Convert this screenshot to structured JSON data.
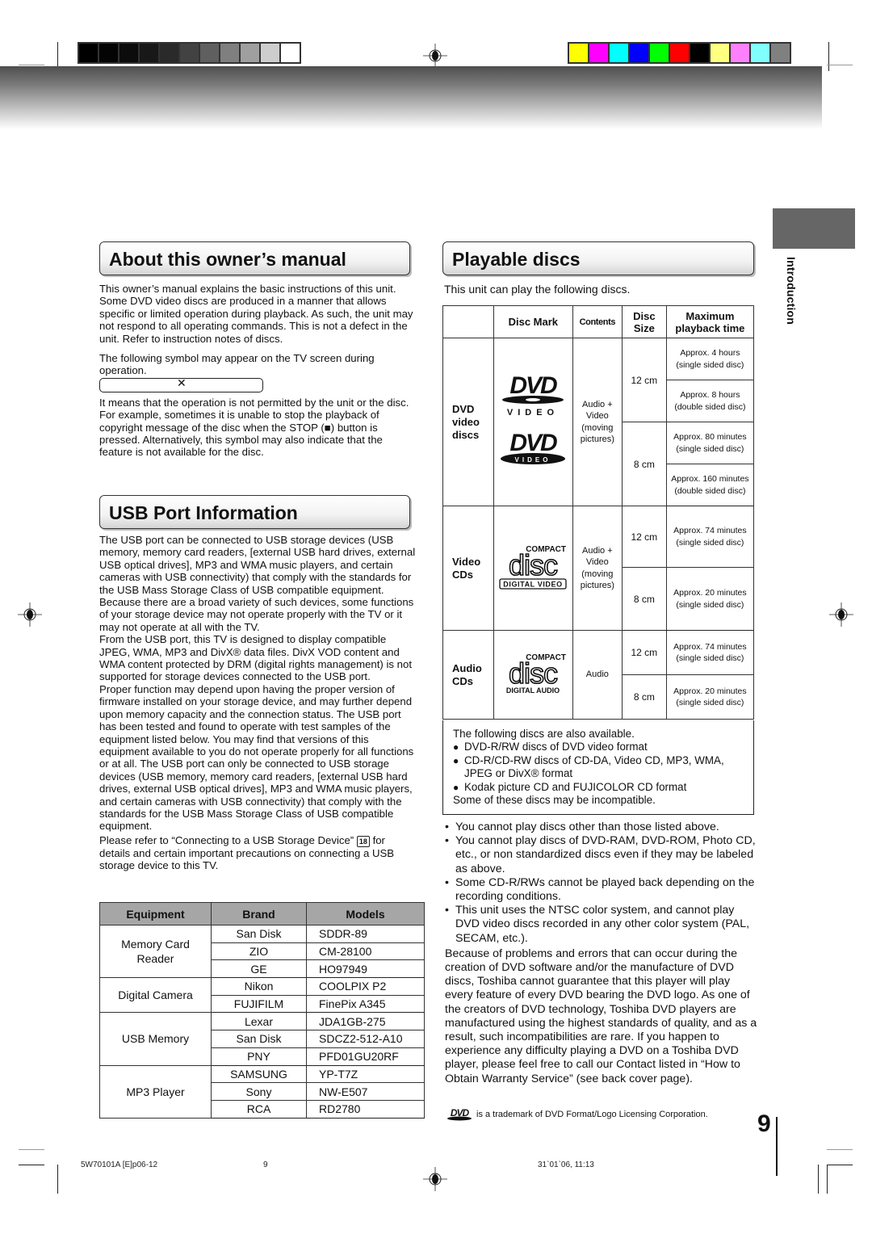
{
  "print_marks": {
    "gray_swatches": [
      "#000000",
      "#040404",
      "#0c0c0c",
      "#181818",
      "#2a2a2a",
      "#424242",
      "#5f5f5f",
      "#7f7f7f",
      "#9f9f9f",
      "#cdcdcd",
      "#ffffff"
    ],
    "color_swatches": [
      "#ffff00",
      "#ff00ff",
      "#00ffff",
      "#0000ff",
      "#00ff00",
      "#ff0000",
      "#000000",
      "#ffff80",
      "#ff80ff",
      "#80ffff",
      "#808080"
    ]
  },
  "side_tab": {
    "label": "Introduction",
    "color": "#666666"
  },
  "about": {
    "title": "About this owner’s manual",
    "p1": "This owner’s manual explains the basic instructions of this unit. Some DVD video discs are produced in a manner that allows specific or limited operation during playback. As such, the unit may not respond to all operating commands. This is not a defect in the unit. Refer to instruction notes of discs.",
    "p2": "The following symbol may appear on the TV screen during operation.",
    "symbol": "✕",
    "p3": "It means that the operation is not permitted by the unit or the disc.",
    "p4a": "For example, sometimes it is unable to stop the playback of copyright message of the disc when the STOP (",
    "stop_glyph": "■",
    "p4b": ") button is pressed. Alternatively, this symbol may also indicate that the feature is not available for the disc."
  },
  "usb": {
    "title": "USB Port Information",
    "p1": "The USB port can be connected to USB storage devices (USB memory, memory card readers, [external USB hard drives, external USB optical drives], MP3 and WMA music players, and certain cameras with USB connectivity) that comply with the standards for the USB Mass Storage Class of USB compatible equipment.  Because there are a broad variety of such devices, some functions of your storage device may not operate properly with the TV or it may not operate at all with the TV.",
    "p2": "From the USB port, this TV is designed to display compatible JPEG, WMA, MP3 and DivX® data files. DivX VOD content and WMA content protected by DRM (digital rights management) is not supported for storage devices connected to the USB port.",
    "p3": "Proper function may depend upon having the proper version of firmware installed on your storage device, and may further depend upon memory capacity and the connection status. The USB port has been tested and found to operate with test samples of the equipment listed below.  You may find that versions of this equipment available to you do not operate properly for all functions or at all. The USB port can only be connected to USB storage devices (USB memory, memory card readers, [external USB hard drives, external USB optical drives], MP3 and WMA music players, and certain cameras with USB connectivity) that comply with the standards for the USB Mass Storage Class of USB compatible equipment.",
    "p4a": "Please refer to “Connecting to a USB Storage Device”",
    "p4_ref": "18",
    "p4b": "for details and certain important precautions on connecting a USB storage device to this TV."
  },
  "equipment_table": {
    "headers": [
      "Equipment",
      "Brand",
      "Models"
    ],
    "groups": [
      {
        "equipment": "Memory Card Reader",
        "rows": [
          [
            "San Disk",
            "SDDR-89"
          ],
          [
            "ZIO",
            "CM-28100"
          ],
          [
            "GE",
            "HO97949"
          ]
        ]
      },
      {
        "equipment": "Digital Camera",
        "rows": [
          [
            "Nikon",
            "COOLPIX P2"
          ],
          [
            "FUJIFILM",
            "FinePix A345"
          ]
        ]
      },
      {
        "equipment": "USB Memory",
        "rows": [
          [
            "Lexar",
            "JDA1GB-275"
          ],
          [
            "San Disk",
            "SDCZ2-512-A10"
          ],
          [
            "PNY",
            "PFD01GU20RF"
          ]
        ]
      },
      {
        "equipment": "MP3 Player",
        "rows": [
          [
            "SAMSUNG",
            "YP-T7Z"
          ],
          [
            "Sony",
            "NW-E507"
          ],
          [
            "RCA",
            "RD2780"
          ]
        ]
      }
    ]
  },
  "playable": {
    "title": "Playable discs",
    "intro": "This unit can play the following discs.",
    "headers": {
      "mark": "Disc Mark",
      "contents": "Contents",
      "size": "Disc Size",
      "time": "Maximum playback time"
    },
    "dvd": {
      "type": "DVD video discs",
      "contents": "Audio + Video (moving pictures)",
      "logo_text": "VIDEO",
      "sizes": [
        "12 cm",
        "8 cm"
      ],
      "times": [
        "Approx. 4 hours (single sided disc)",
        "Approx. 8 hours (double sided disc)",
        "Approx. 80 minutes (single sided disc)",
        "Approx. 160 minutes (double sided disc)"
      ]
    },
    "vcd": {
      "type": "Video CDs",
      "contents": "Audio + Video (moving pictures)",
      "logo_top": "COMPACT",
      "logo_bottom": "DIGITAL VIDEO",
      "sizes": [
        "12 cm",
        "8 cm"
      ],
      "times": [
        "Approx. 74 minutes (single sided disc)",
        "Approx. 20 minutes (single sided disc)"
      ]
    },
    "acd": {
      "type": "Audio CDs",
      "contents": "Audio",
      "logo_top": "COMPACT",
      "logo_bottom": "DIGITAL AUDIO",
      "sizes": [
        "12 cm",
        "8 cm"
      ],
      "times": [
        "Approx. 74 minutes (single sided disc)",
        "Approx. 20 minutes (single sided disc)"
      ]
    },
    "also": {
      "intro": "The following discs are also available.",
      "items": [
        "DVD-R/RW discs of DVD video format",
        "CD-R/CD-RW discs of CD-DA, Video CD, MP3, WMA, JPEG or DivX® format",
        "Kodak picture CD and FUJICOLOR CD format"
      ],
      "outro": "Some of these discs may be incompatible."
    },
    "notes": [
      "You cannot play discs other than those listed above.",
      "You cannot play discs of DVD-RAM, DVD-ROM, Photo CD, etc., or non standardized discs even if they may be labeled as above.",
      "Some CD-R/RWs cannot be played back depending on the recording conditions.",
      "This unit uses the NTSC color system, and cannot play DVD video discs recorded in any other color system (PAL, SECAM, etc.)."
    ],
    "paragraph": "Because of problems and errors that can occur during the creation of DVD software and/or the manufacture of DVD discs, Toshiba cannot guarantee that this player will play every feature of every DVD bearing the DVD logo.  As one of the creators of DVD technology, Toshiba DVD players are manufactured using the highest standards of quality, and as a result, such incompatibilities are rare.  If you happen to experience any difficulty playing a DVD on a Toshiba DVD player, please feel free to call our Contact listed in “How to Obtain Warranty Service” (see back cover page).",
    "trademark": "is a trademark of DVD Format/Logo Licensing Corporation."
  },
  "page_number": "9",
  "footer": {
    "file": "5W70101A [E]p06-12",
    "page": "9",
    "timestamp": "31`01`06, 11:13"
  }
}
